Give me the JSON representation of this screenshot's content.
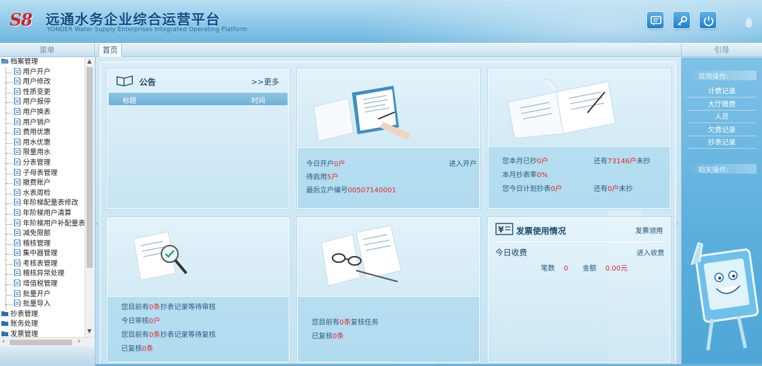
{
  "header": {
    "logo_text": "S8",
    "title_cn": "远通水务企业综合运营平台",
    "title_en": "YONDER Water Supply Enterprises Integrated Operating Platform",
    "buttons": [
      {
        "name": "message-icon"
      },
      {
        "name": "key-icon"
      },
      {
        "name": "power-icon"
      }
    ]
  },
  "strip": {
    "menu_label": "菜单",
    "home_tab": "首页",
    "guide_label": "引导"
  },
  "tree": {
    "root": "档案管理",
    "children": [
      "用户开户",
      "用户修改",
      "性质变更",
      "用户报停",
      "用户换表",
      "用户销户",
      "费用优惠",
      "用水优惠",
      "限量用水",
      "分表管理",
      "子母表管理",
      "撤费账户",
      "水表周检",
      "年阶梯配量表修改",
      "年阶梯用户清算",
      "年阶梯用户补配量表",
      "减免限额",
      "稽核管理",
      "集中器管理",
      "考核表管理",
      "稽核异常处理",
      "增值税管理",
      "批量开户",
      "批量导入"
    ],
    "others": [
      "抄表管理",
      "账务处理",
      "发票管理"
    ]
  },
  "notice": {
    "title": "公告",
    "more": ">>更多",
    "col_title": "标题",
    "col_time": "时间"
  },
  "open_panel": {
    "today_prefix": "今日开户",
    "today_value": "0户",
    "pending_prefix": "待启用",
    "pending_value": "5户",
    "last_prefix": "最后立户编号",
    "last_value": "00507140001",
    "enter_link": "进入开户"
  },
  "meter_panel": {
    "month_read_prefix": "您本月已抄",
    "month_read_value": "0户",
    "remain_prefix": "还有",
    "remain_value": "73146户",
    "remain_suffix": "未抄",
    "rate_prefix": "本月抄表率",
    "rate_value": "0%",
    "plan_prefix": "您今日计划抄表",
    "plan_value": "0户",
    "plan_remain_prefix": "还有",
    "plan_remain_value": "0户",
    "plan_remain_suffix": "未抄"
  },
  "audit_panel": {
    "line1_prefix": "您目前有",
    "line1_value": "0条",
    "line1_suffix": "抄表记录等待审核",
    "line2_prefix": "今日审核",
    "line2_value": "0户",
    "line3_prefix": "您目前有",
    "line3_value": "0条",
    "line3_suffix": "抄表记录等待复核",
    "line4_prefix": "已复核",
    "line4_value": "0条"
  },
  "review_panel": {
    "line1_prefix": "您目前有",
    "line1_value": "0条",
    "line1_suffix": "复核任务",
    "line2_prefix": "已复核",
    "line2_value": "0条"
  },
  "invoice_panel": {
    "title": "发票使用情况",
    "link": "发票领用",
    "today_label": "今日收费",
    "enter_link": "进入收费",
    "count_label": "笔数",
    "count_value": "0",
    "amount_label": "金额",
    "amount_value": "0.00元"
  },
  "right": {
    "common_ops": "常用操作:",
    "links": [
      "计费记录",
      "大厅缴费",
      "人员",
      "欠费记录",
      "抄表记录"
    ],
    "related_ops": "相关操作:"
  }
}
